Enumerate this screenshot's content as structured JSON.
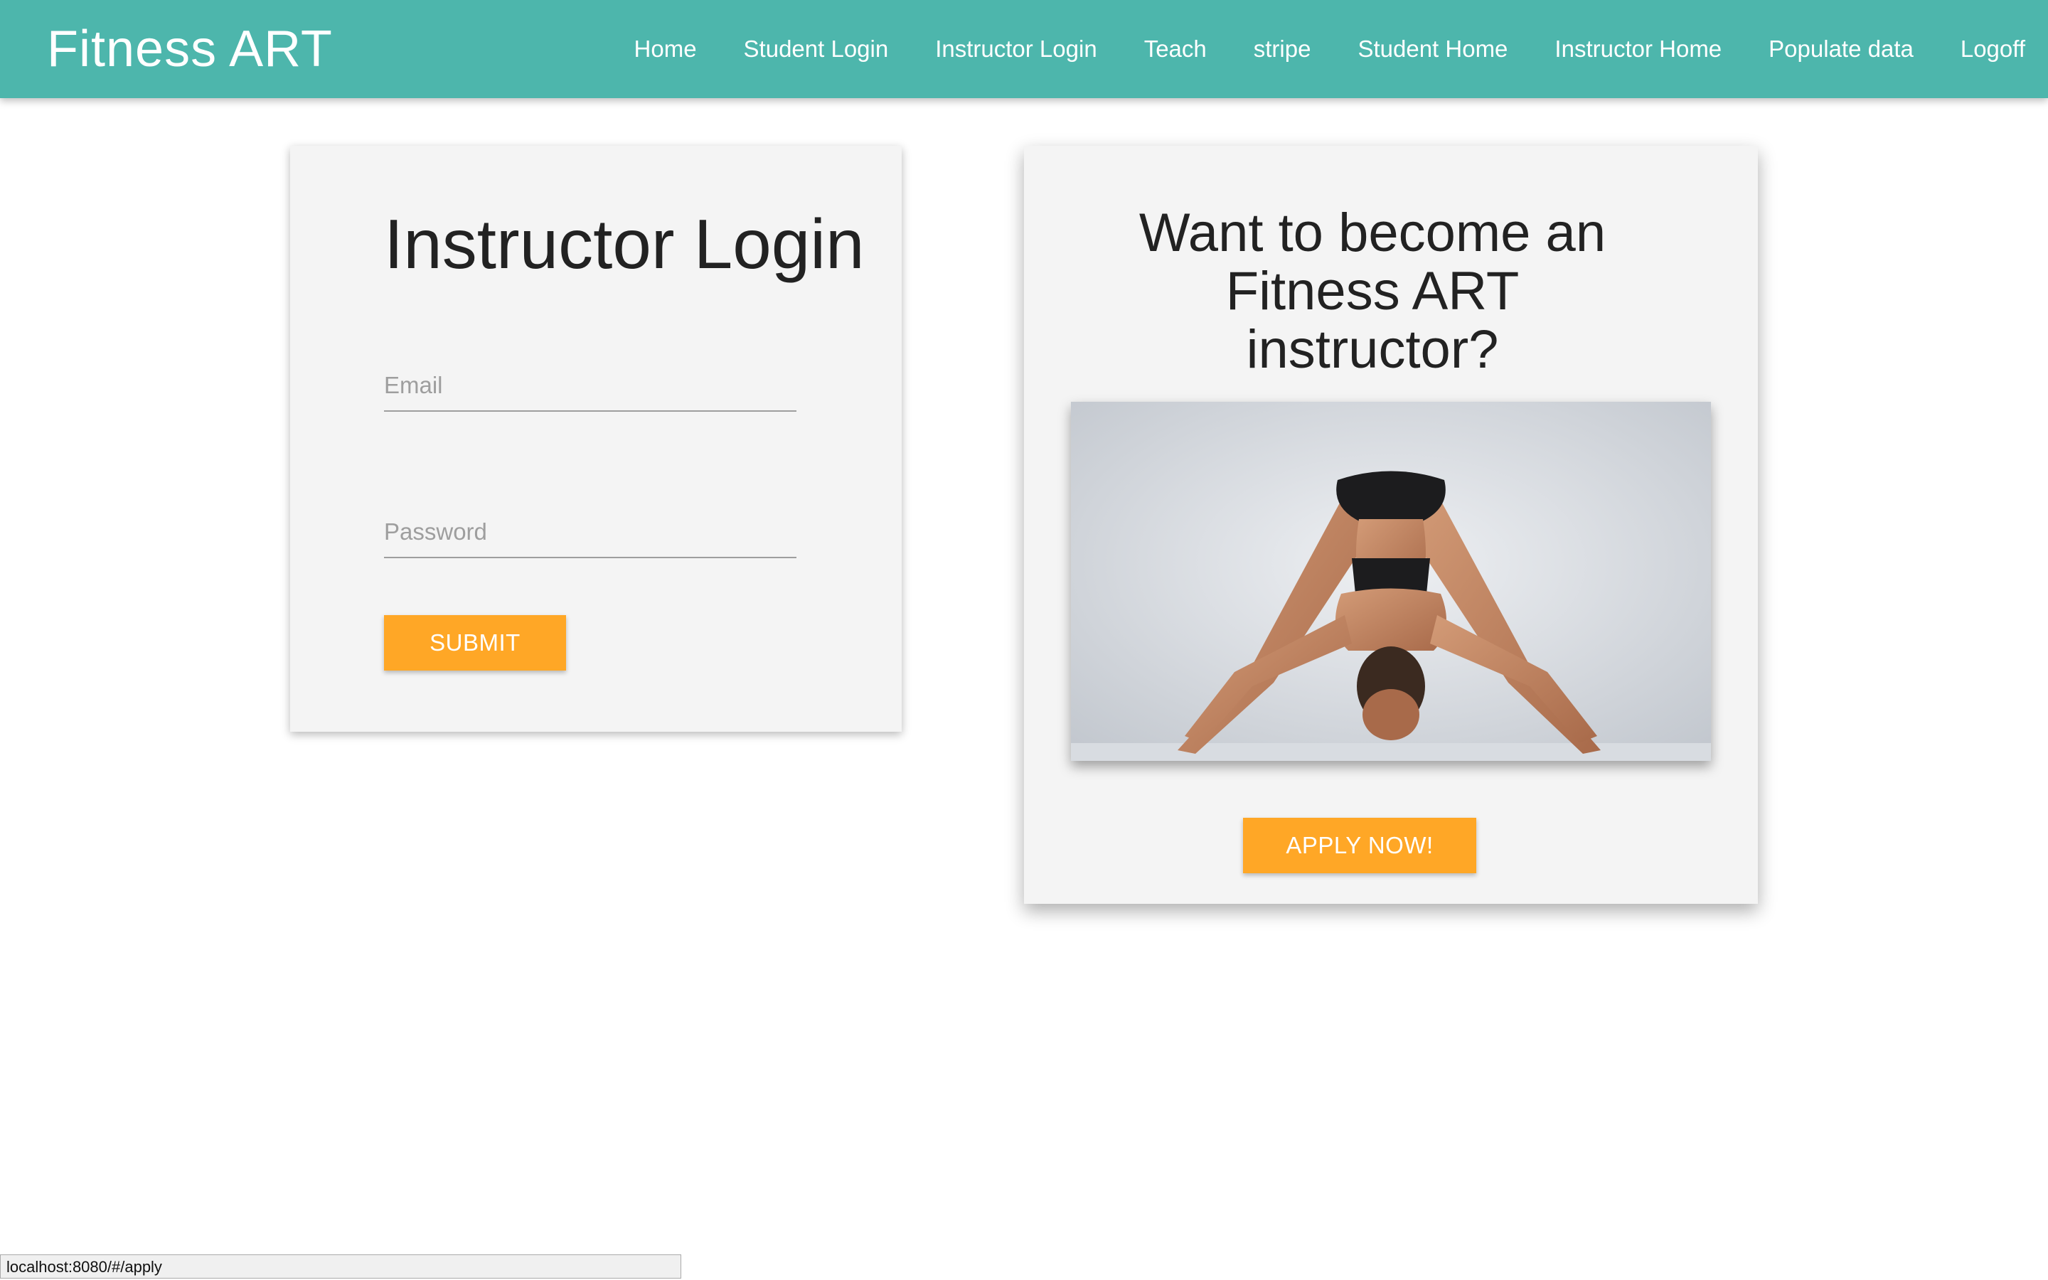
{
  "navbar": {
    "brand": "Fitness ART",
    "background_color": "#4db6ac",
    "links": [
      {
        "label": "Home"
      },
      {
        "label": "Student Login"
      },
      {
        "label": "Instructor Login"
      },
      {
        "label": "Teach"
      },
      {
        "label": "stripe"
      },
      {
        "label": "Student Home"
      },
      {
        "label": "Instructor Home"
      },
      {
        "label": "Populate data"
      },
      {
        "label": "Logoff"
      }
    ]
  },
  "login_card": {
    "title": "Instructor Login",
    "email": {
      "placeholder": "Email",
      "value": ""
    },
    "password": {
      "placeholder": "Password",
      "value": ""
    },
    "submit_label": "SUBMIT"
  },
  "apply_card": {
    "title_line1": "Want to become an",
    "title_line2": "Fitness ART",
    "title_line3": "instructor?",
    "image": "yoga-pose-photo",
    "apply_label": "APPLY NOW!"
  },
  "status_bar": {
    "url": "localhost:8080/#/apply"
  },
  "colors": {
    "accent_button": "#ffa726",
    "card_background": "#f4f4f4"
  }
}
